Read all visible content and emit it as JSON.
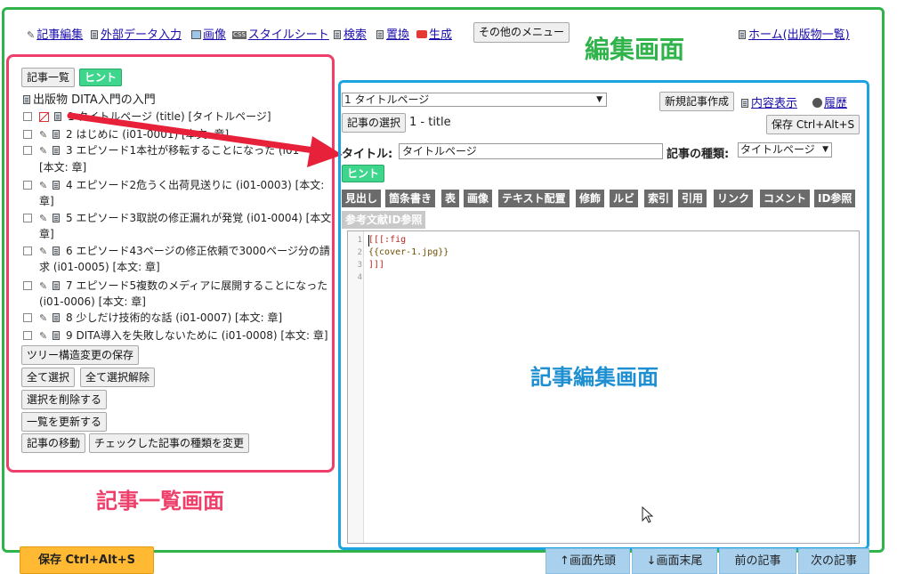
{
  "nav": {
    "article_edit": "記事編集",
    "external_data": "外部データ入力",
    "image": "画像",
    "css_badge": "CSS",
    "stylesheet": "スタイルシート",
    "search": "検索",
    "replace": "置換",
    "generate": "生成",
    "other_menu": "その他のメニュー",
    "home": "ホーム(出版物一覧)"
  },
  "annotations": {
    "edit_screen": "編集画面",
    "article_list_screen": "記事一覧画面",
    "article_edit_screen": "記事編集画面"
  },
  "left": {
    "article_list_button": "記事一覧",
    "hint_button": "ヒント",
    "publication_title": "出版物 DITA入門の入門",
    "tree": [
      {
        "lines": [
          "1 タイトルページ (title) [タイトルページ]"
        ]
      },
      {
        "lines": [
          "2 はじめに (i01-0001) [本文: 章]"
        ]
      },
      {
        "lines": [
          "3 エピソード1本社が移転することになった (i01-",
          "[本文: 章]"
        ]
      },
      {
        "lines": [
          "4 エピソード2危うく出荷見送りに (i01-0003) [本文:",
          "章]"
        ]
      },
      {
        "lines": [
          "5 エピソード3取説の修正漏れが発覚 (i01-0004) [本文:",
          "章]"
        ]
      },
      {
        "lines": [
          "6 エピソード43ページの修正依頼で3000ページ分の請",
          "求 (i01-0005) [本文: 章]"
        ]
      },
      {
        "lines": [
          "7 エピソード5複数のメディアに展開することになった",
          "(i01-0006) [本文: 章]"
        ]
      },
      {
        "lines": [
          "8 少しだけ技術的な話 (i01-0007) [本文: 章]"
        ]
      },
      {
        "lines": [
          "9 DITA導入を失敗しないために (i01-0008) [本文: 章]"
        ]
      }
    ],
    "save_tree": "ツリー構造変更の保存",
    "select_all": "全て選択",
    "deselect_all": "全て選択解除",
    "delete_selected": "選択を削除する",
    "refresh_list": "一覧を更新する",
    "move_article": "記事の移動",
    "change_type": "チェックした記事の種類を変更"
  },
  "editor": {
    "article_select_value": "1 タイトルページ",
    "new_article": "新規記事作成",
    "content_view": "内容表示",
    "history": "履歴",
    "select_article": "記事の選択",
    "current_article": "1 - title",
    "save": "保存 Ctrl+Alt+S",
    "title_label": "タイトル:",
    "title_value": "タイトルページ",
    "type_label": "記事の種類:",
    "type_value": "タイトルページ",
    "hint": "ヒント",
    "toolbar": [
      "見出し",
      "箇条書き",
      "表",
      "画像",
      "テキスト配置",
      "修飾",
      "ルビ",
      "索引",
      "引用",
      "リンク",
      "コメント",
      "ID参照"
    ],
    "toolbar_row2": [
      "参考文献ID参照"
    ],
    "line_numbers": [
      "1",
      "2",
      "3",
      "4"
    ],
    "code_lines": [
      "[[[:fig",
      "{{cover-1.jpg}}",
      "]]]",
      ""
    ]
  },
  "bottom": {
    "save": "保存 Ctrl+Alt+S",
    "to_top": "↑画面先頭",
    "to_bottom": "↓画面末尾",
    "prev_article": "前の記事",
    "next_article": "次の記事"
  },
  "colors": {
    "green_frame": "#2fb34a",
    "red_frame": "#ee3e6a",
    "blue_frame": "#1ea3e2",
    "hint_green": "#3dd68c",
    "save_orange": "#ffb932"
  }
}
